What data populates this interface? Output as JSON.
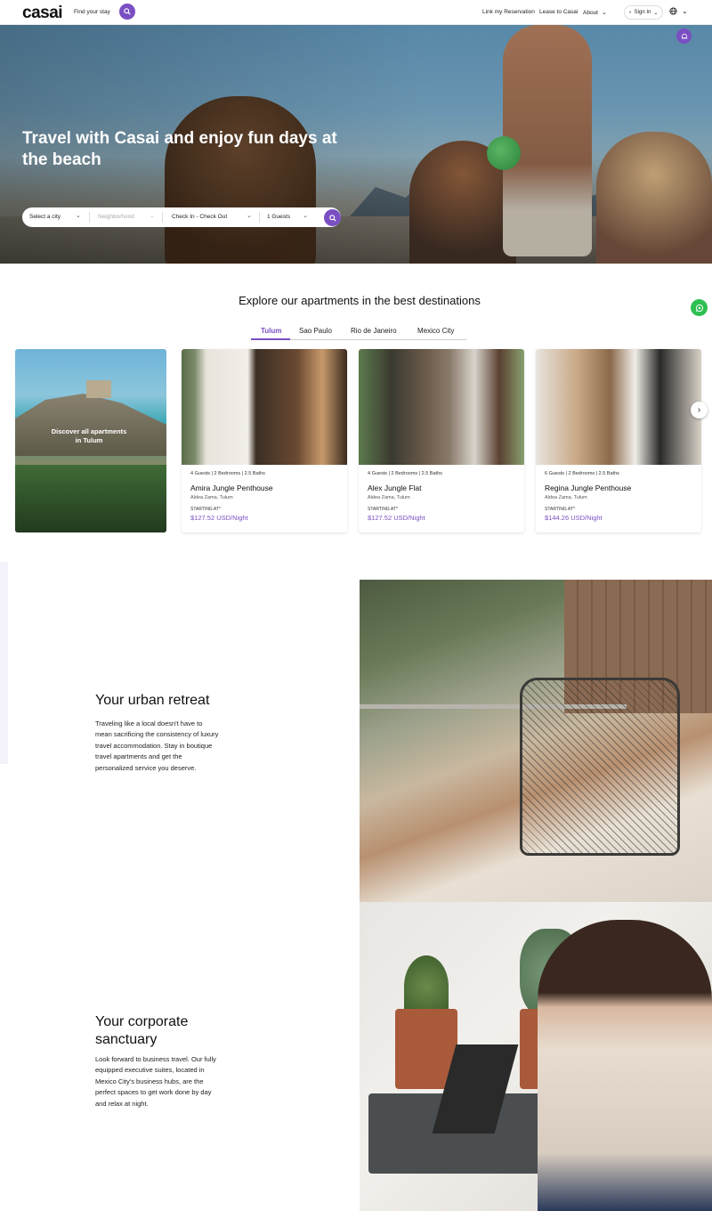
{
  "header": {
    "logo": "casai",
    "find_stay": "Find your stay",
    "link_reservation": "Link my Reservation",
    "lease": "Lease to Casai",
    "about": "About",
    "sign_in": "Sign In"
  },
  "hero": {
    "title": "Travel with Casai and enjoy fun days at the beach",
    "search": {
      "city": "Select a city",
      "neighborhood": "Neighborhood",
      "dates": "Check In - Check Out",
      "guests": "1 Guests"
    }
  },
  "explore": {
    "title": "Explore our apartments in the best destinations",
    "tabs": [
      "Tulum",
      "Sao Paulo",
      "Rio de Janeiro",
      "Mexico City"
    ],
    "discover_label": "Discover all apartments in Tulum",
    "cards": [
      {
        "meta": "4 Guests | 2 Bedrooms | 2.5 Baths",
        "name": "Amira Jungle Penthouse",
        "location": "Aldea Zama, Tulum",
        "starting": "STARTING AT*",
        "price": "$127.52 USD/Night"
      },
      {
        "meta": "4 Guests | 2 Bedrooms | 2.5 Baths",
        "name": "Alex Jungle Flat",
        "location": "Aldea Zama, Tulum",
        "starting": "STARTING AT*",
        "price": "$127.52 USD/Night"
      },
      {
        "meta": "6 Guests | 2 Bedrooms | 2.5 Baths",
        "name": "Regina Jungle Penthouse",
        "location": "Aldea Zama, Tulum",
        "starting": "STARTING AT*",
        "price": "$144.26 USD/Night"
      }
    ]
  },
  "features": [
    {
      "title": "Your urban retreat",
      "description": "Traveling like a local doesn't have to mean sacrificing the consistency of luxury travel accommodation. Stay in boutique travel apartments and get the personalized service you deserve."
    },
    {
      "title": "Your corporate sanctuary",
      "description": "Look forward to business travel. Our fully equipped executive suites, located in Mexico City's business hubs, are the perfect spaces to get work done by day and relax at night."
    }
  ],
  "colors": {
    "accent": "#7a4fc2",
    "whatsapp": "#2fbf52"
  }
}
